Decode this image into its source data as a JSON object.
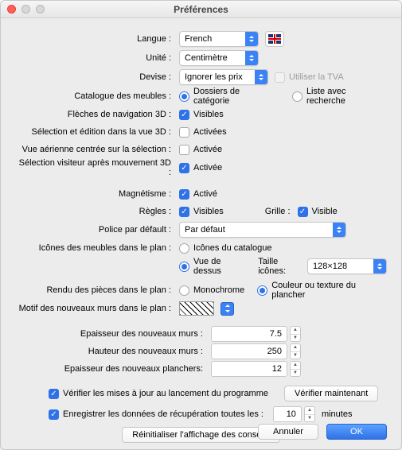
{
  "window": {
    "title": "Préférences"
  },
  "langue": {
    "label": "Langue :",
    "value": "French"
  },
  "unite": {
    "label": "Unité :",
    "value": "Centimètre"
  },
  "devise": {
    "label": "Devise :",
    "value": "Ignorer les prix",
    "vat": "Utiliser la TVA"
  },
  "catalogue": {
    "label": "Catalogue des meubles :",
    "opt1": "Dossiers de catégorie",
    "opt2": "Liste avec recherche"
  },
  "nav3d": {
    "label": "Flèches de navigation 3D :",
    "opt": "Visibles"
  },
  "selEdit3d": {
    "label": "Sélection et édition dans la vue 3D :",
    "opt": "Activées"
  },
  "vueAerienne": {
    "label": "Vue aérienne centrée sur la sélection :",
    "opt": "Activée"
  },
  "selVisiteur": {
    "label": "Sélection visiteur après mouvement 3D :",
    "opt": "Activée"
  },
  "magnetisme": {
    "label": "Magnétisme :",
    "opt": "Activé"
  },
  "regles": {
    "label": "Règles :",
    "opt": "Visibles",
    "gridlabel": "Grille :",
    "gridopt": "Visible"
  },
  "police": {
    "label": "Police par défault :",
    "value": "Par défaut"
  },
  "iconesPlan": {
    "label": "Icônes des meubles dans le plan :",
    "opt1": "Icônes du catalogue",
    "opt2": "Vue de dessus",
    "sizelabel": "Taille icônes:",
    "sizevalue": "128×128"
  },
  "renduPieces": {
    "label": "Rendu des pièces dans le plan :",
    "opt1": "Monochrome",
    "opt2": "Couleur ou texture du plancher"
  },
  "motifMurs": {
    "label": "Motif des nouveaux murs dans le plan :"
  },
  "epMurs": {
    "label": "Epaisseur des nouveaux murs :",
    "value": "7.5"
  },
  "htMurs": {
    "label": "Hauteur des nouveaux murs :",
    "value": "250"
  },
  "epPlanchers": {
    "label": "Epaisseur des nouveaux planchers:",
    "value": "12"
  },
  "updates": {
    "label": "Vérifier les mises à jour au lancement du programme",
    "button": "Vérifier maintenant"
  },
  "recovery": {
    "label1": "Enregistrer les données de récupération toutes les :",
    "value": "10",
    "unit": "minutes"
  },
  "reset": {
    "label": "Réinitialiser l'affichage des conseils"
  },
  "buttons": {
    "cancel": "Annuler",
    "ok": "OK"
  }
}
